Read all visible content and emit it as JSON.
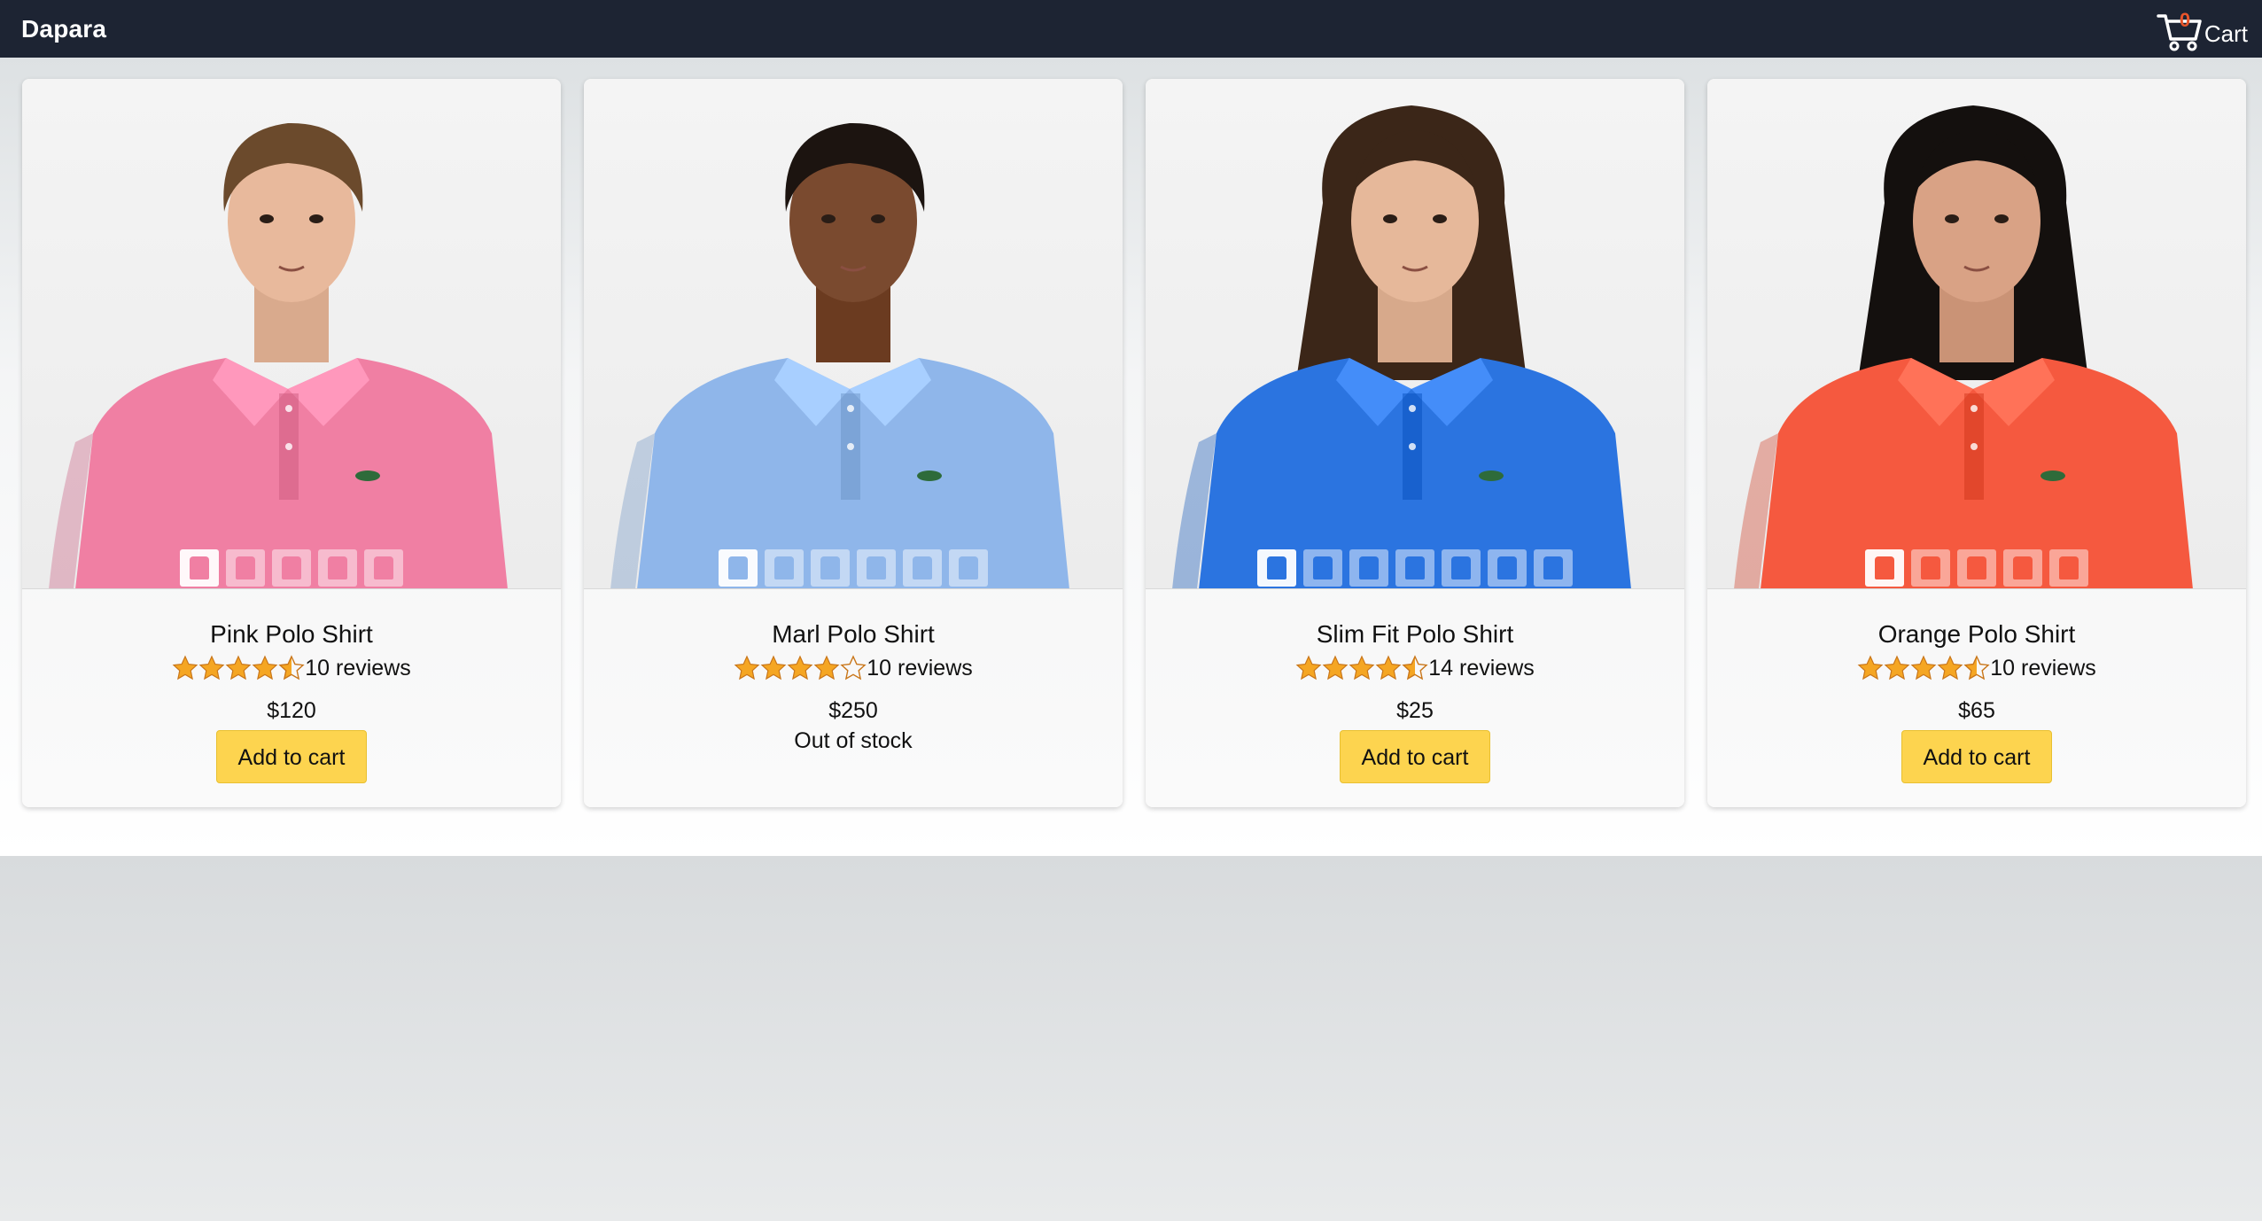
{
  "navbar": {
    "brand": "Dapara",
    "cart_count": "0",
    "cart_label": "Cart"
  },
  "colors": {
    "navbar_bg": "#1d2433",
    "button_bg": "#fdd44f",
    "star": "#f5a623",
    "cart_count": "#e8552b"
  },
  "products": [
    {
      "name": "Pink Polo Shirt",
      "rating": 4.5,
      "reviews": "10 reviews",
      "price": "$120",
      "button": "Add to cart",
      "in_stock": true,
      "shirt_color": "#f07fa3",
      "thumb_count": 5
    },
    {
      "name": "Marl Polo Shirt",
      "rating": 4,
      "reviews": "10 reviews",
      "price": "$250",
      "stock_text": "Out of stock",
      "in_stock": false,
      "shirt_color": "#8fb6ea",
      "thumb_count": 6
    },
    {
      "name": "Slim Fit Polo Shirt",
      "rating": 4.5,
      "reviews": "14 reviews",
      "price": "$25",
      "button": "Add to cart",
      "in_stock": true,
      "shirt_color": "#2b74e0",
      "thumb_count": 7
    },
    {
      "name": "Orange Polo Shirt",
      "rating": 4.5,
      "reviews": "10 reviews",
      "price": "$65",
      "button": "Add to cart",
      "in_stock": true,
      "shirt_color": "#f5593f",
      "thumb_count": 5
    }
  ]
}
